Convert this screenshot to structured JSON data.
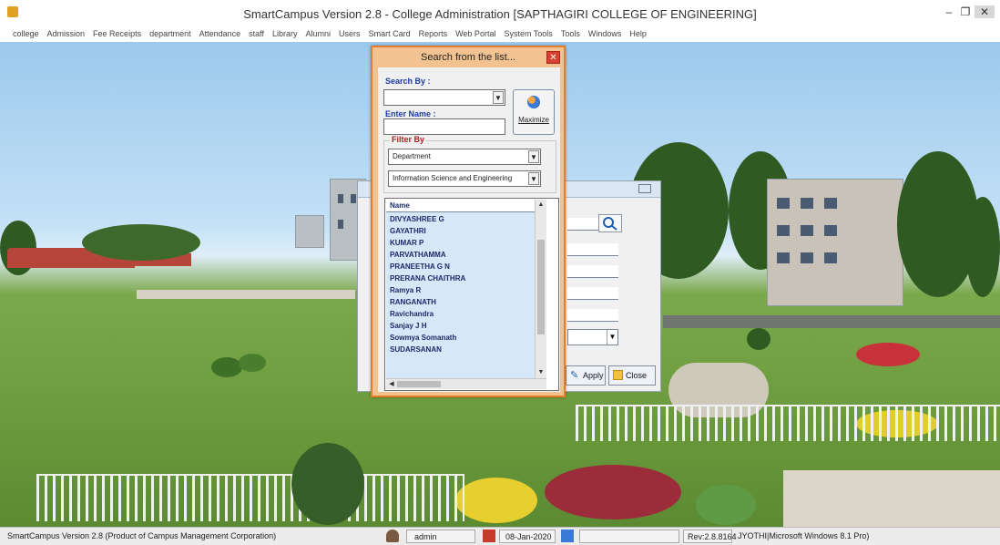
{
  "window": {
    "title": "SmartCampus Version 2.8 - College Administration [SAPTHAGIRI COLLEGE OF ENGINEERING]",
    "minimize": "–",
    "restore": "❐",
    "close": "✕"
  },
  "menu": {
    "items": [
      "college",
      "Admission",
      "Fee Receipts",
      "department",
      "Attendance",
      "staff",
      "Library",
      "Alumni",
      "Users",
      "Smart Card",
      "Reports",
      "Web Portal",
      "System Tools",
      "Tools",
      "Windows",
      "Help"
    ]
  },
  "search_dialog": {
    "title": "Search from the list...",
    "close_label": "✕",
    "search_by_label": "Search By :",
    "search_by_value": "",
    "enter_name_label": "Enter Name :",
    "enter_name_value": "",
    "maximize_label": "Maximize",
    "filter_by_label": "Filter By",
    "filter_field_value": "Department",
    "filter_value": "Information Science and Engineering",
    "list": {
      "header": "Name",
      "rows": [
        "DIVYASHREE G",
        "GAYATHRI",
        "KUMAR P",
        "PARVATHAMMA",
        "PRANEETHA G N",
        "PRERANA CHAITHRA",
        "Ramya R",
        "RANGANATH",
        "Ravichandra",
        "Sanjay J H",
        "Sowmya Somanath",
        "SUDARSANAN"
      ]
    }
  },
  "back_dialog": {
    "apply_label": "Apply",
    "close_label": "Close"
  },
  "status_bar": {
    "product": "SmartCampus Version 2.8 (Product of Campus Management Corporation)",
    "user": "admin",
    "date": "08-Jan-2020",
    "revision": "Rev:2.8.8164",
    "machine": "JYOTHI|Microsoft Windows 8.1 Pro)"
  },
  "colors": {
    "dialog_border": "#e37f2c",
    "dialog_frame": "#f2c391",
    "label_blue": "#1e3aa0",
    "label_red": "#b01e1e",
    "list_bg": "#d6e8f7"
  }
}
